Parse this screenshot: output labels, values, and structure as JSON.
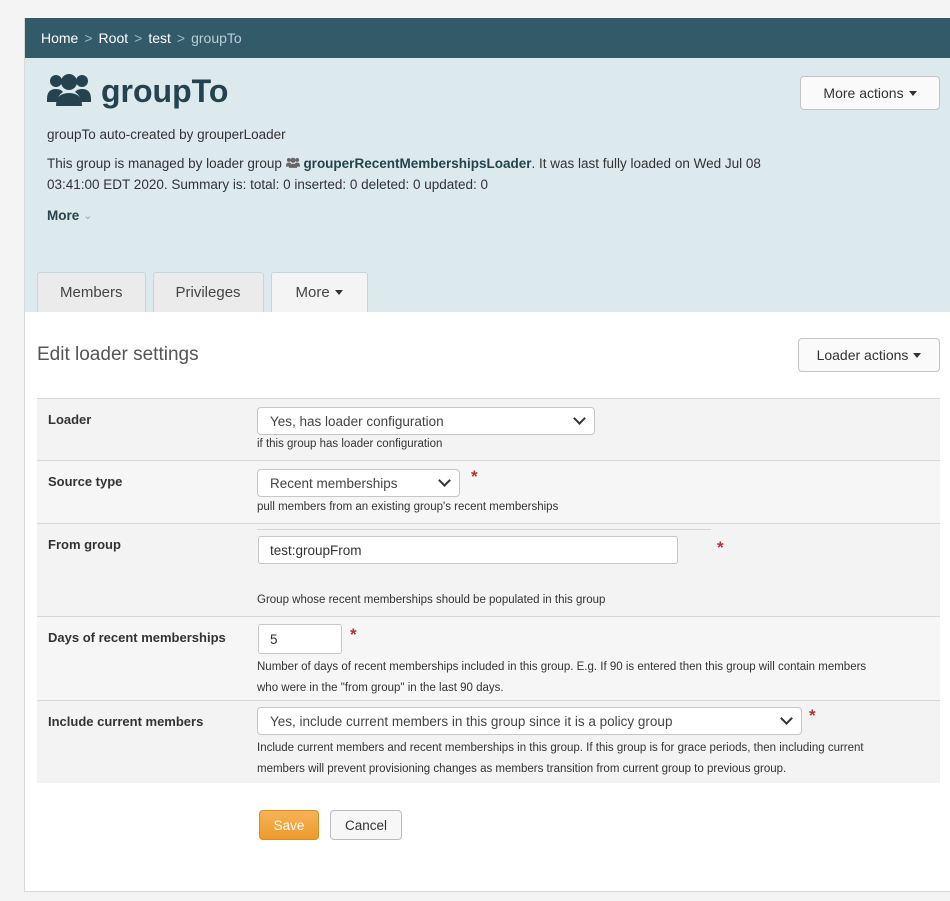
{
  "breadcrumb": {
    "home": "Home",
    "root": "Root",
    "test": "test",
    "current": "groupTo"
  },
  "header": {
    "title": "groupTo",
    "description": "groupTo auto-created by grouperLoader",
    "loader_prefix": "This group is managed by loader group",
    "loader_group": "grouperRecentMembershipsLoader",
    "loader_suffix": ". It was last fully loaded on Wed Jul 08 03:41:00 EDT 2020. Summary is: total: 0 inserted: 0 deleted: 0 updated: 0",
    "more_label": "More",
    "more_actions_label": "More actions"
  },
  "tabs": [
    {
      "label": "Members"
    },
    {
      "label": "Privileges"
    },
    {
      "label": "More"
    }
  ],
  "section": {
    "title": "Edit loader settings",
    "loader_actions_label": "Loader actions"
  },
  "form": {
    "loader": {
      "label": "Loader",
      "value": "Yes, has loader configuration",
      "help": "if this group has loader configuration"
    },
    "source_type": {
      "label": "Source type",
      "value": "Recent memberships",
      "help": "pull members from an existing group's recent memberships"
    },
    "from_group": {
      "label": "From group",
      "value": "test:groupFrom",
      "help": "Group whose recent memberships should be populated in this group"
    },
    "days": {
      "label": "Days of recent memberships",
      "value": "5",
      "help_1": "Number of days of recent memberships included in this group. E.g. If 90 is entered then this group will contain members",
      "help_2": "who were in the \"from group\" in the last 90 days."
    },
    "include_current": {
      "label": "Include current members",
      "value": "Yes, include current members in this group since it is a policy group",
      "help_1": "Include current members and recent memberships in this group. If this group is for grace periods, then including current",
      "help_2": "members will prevent provisioning changes as members transition from current group to previous group."
    },
    "required_mark": "*"
  },
  "buttons": {
    "save": "Save",
    "cancel": "Cancel"
  },
  "colors": {
    "breadcrumb_bg": "#325a68",
    "header_bg": "#dce9ed",
    "accent": "#24434f",
    "save": "#f0a035",
    "required": "#b3322e"
  },
  "icons": {
    "group": "users-icon"
  }
}
